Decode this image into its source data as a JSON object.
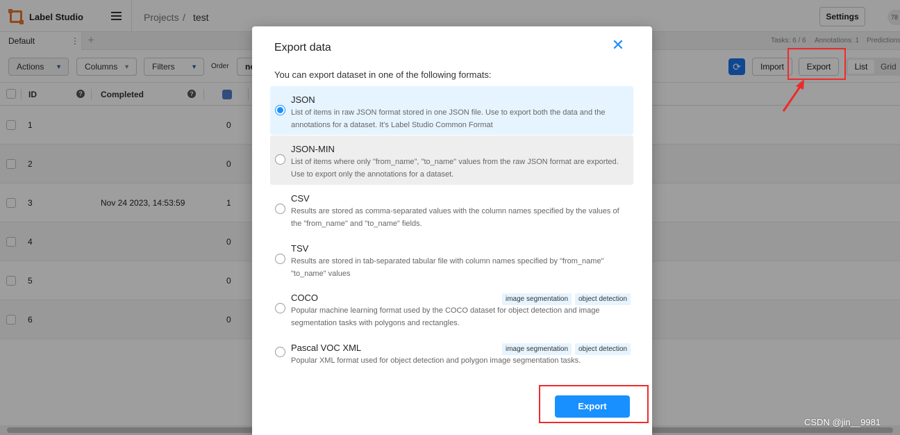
{
  "app": {
    "name": "Label Studio"
  },
  "breadcrumb": {
    "projects": "Projects",
    "separator": "/",
    "current": "test"
  },
  "header": {
    "settings": "Settings",
    "avatar": "78"
  },
  "tabs": {
    "default": "Default",
    "menu": "⋮",
    "add": "+"
  },
  "stats": {
    "tasks": "Tasks: 6 / 6",
    "annotations": "Annotations: 1",
    "predictions": "Predictions"
  },
  "toolbar": {
    "actions": "Actions",
    "columns": "Columns",
    "filters": "Filters",
    "order": "Order",
    "order_value": "no",
    "import": "Import",
    "export": "Export",
    "list": "List",
    "grid": "Grid"
  },
  "table": {
    "columns": {
      "id": "ID",
      "completed": "Completed"
    },
    "rows": [
      {
        "id": "1",
        "completed": "",
        "count": "0"
      },
      {
        "id": "2",
        "completed": "",
        "count": "0"
      },
      {
        "id": "3",
        "completed": "Nov 24 2023, 14:53:59",
        "count": "1"
      },
      {
        "id": "4",
        "completed": "",
        "count": "0"
      },
      {
        "id": "5",
        "completed": "",
        "count": "0"
      },
      {
        "id": "6",
        "completed": "",
        "count": "0"
      }
    ]
  },
  "modal": {
    "title": "Export data",
    "subtitle": "You can export dataset in one of the following formats:",
    "formats": [
      {
        "title": "JSON",
        "desc": "List of items in raw JSON format stored in one JSON file. Use to export both the data and the annotations for a dataset. It's Label Studio Common Format",
        "tags": []
      },
      {
        "title": "JSON-MIN",
        "desc": "List of items where only \"from_name\", \"to_name\" values from the raw JSON format are exported. Use to export only the annotations for a dataset.",
        "tags": []
      },
      {
        "title": "CSV",
        "desc": "Results are stored as comma-separated values with the column names specified by the values of the \"from_name\" and \"to_name\" fields.",
        "tags": []
      },
      {
        "title": "TSV",
        "desc": "Results are stored in tab-separated tabular file with column names specified by \"from_name\" \"to_name\" values",
        "tags": []
      },
      {
        "title": "COCO",
        "desc": "Popular machine learning format used by the COCO dataset for object detection and image segmentation tasks with polygons and rectangles.",
        "tags": [
          "image segmentation",
          "object detection"
        ]
      },
      {
        "title": "Pascal VOC XML",
        "desc": "Popular XML format used for object detection and polygon image segmentation tasks.",
        "tags": [
          "image segmentation",
          "object detection"
        ]
      }
    ],
    "selected_format": "JSON",
    "export_button": "Export",
    "close": "✕"
  },
  "watermark": "CSDN @jin__9981",
  "colors": {
    "primary": "#1890ff",
    "annotation": "#ee2a2a",
    "brand": "#e8772e"
  }
}
